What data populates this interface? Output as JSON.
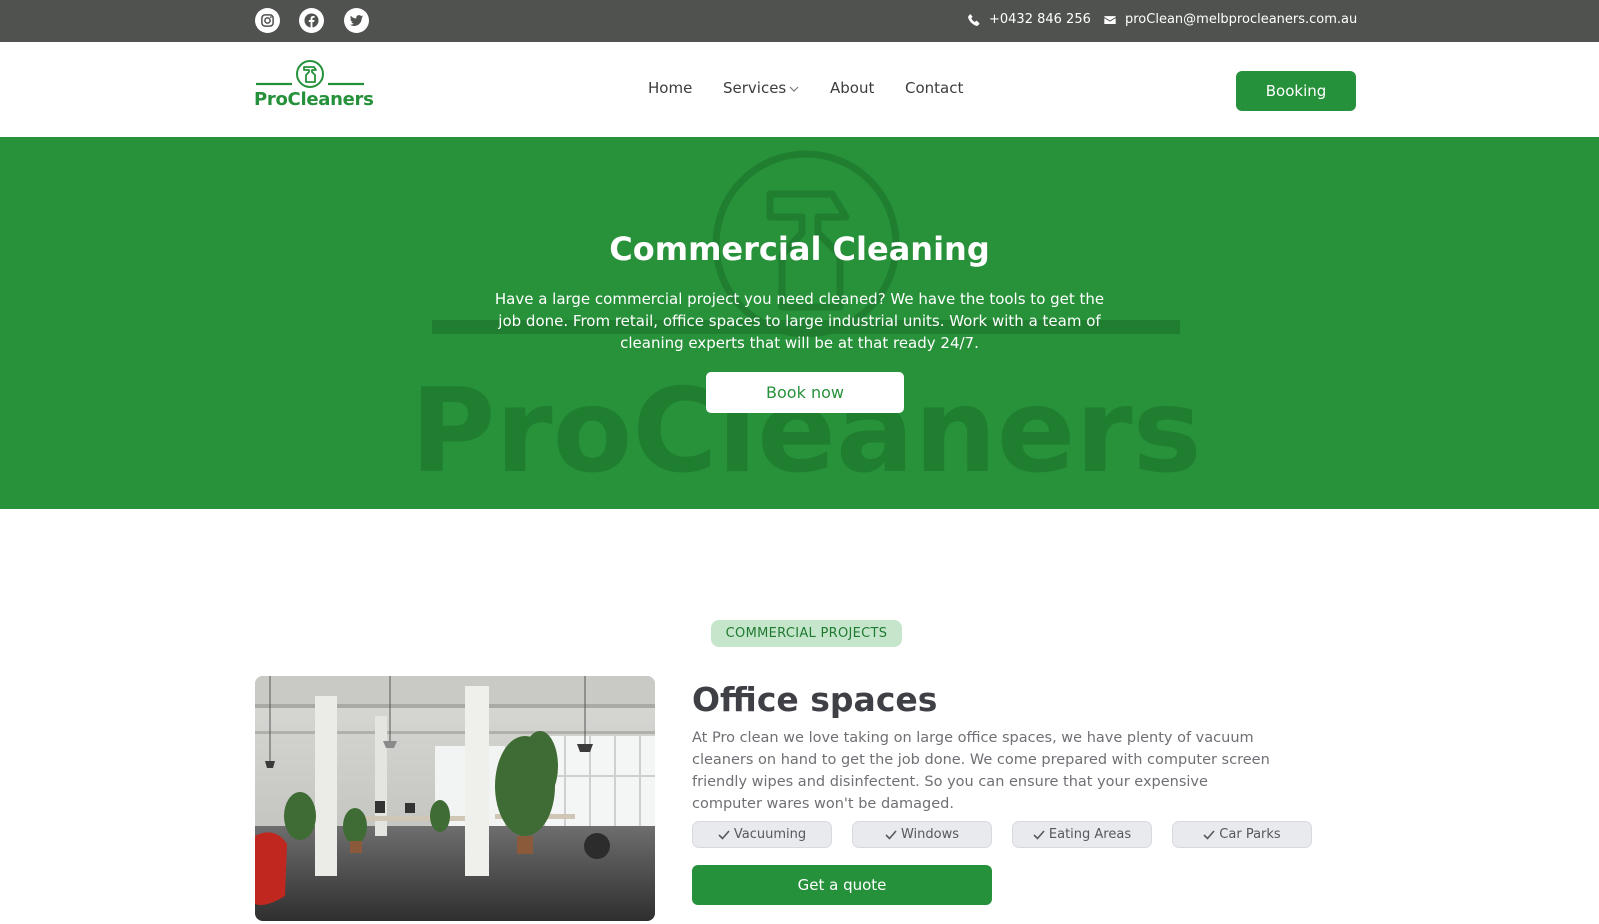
{
  "topbar": {
    "social": [
      {
        "icon": "instagram-icon"
      },
      {
        "icon": "facebook-icon"
      },
      {
        "icon": "twitter-icon"
      }
    ],
    "phone": "+0432 846 256",
    "email": "proClean@melbprocleaners.com.au"
  },
  "nav": {
    "logo_text": "ProCleaners",
    "items": [
      "Home",
      "Services",
      "About",
      "Contact"
    ],
    "booking_label": "Booking"
  },
  "hero": {
    "title": "Commercial Cleaning",
    "description": "Have a large commercial project you need cleaned? We have the tools to get the job done. From retail, office spaces to large industrial units. Work with a team of cleaning experts that will be at that ready 24/7.",
    "button_label": "Book now",
    "watermark_text": "ProCleaners"
  },
  "projects": {
    "section_label": "COMMERCIAL PROJECTS",
    "title": "Office spaces",
    "description": "At Pro clean we love taking on large office spaces, we have plenty of vacuum cleaners on hand to get the job done. We come prepared with computer screen friendly wipes and disinfectent. So you can ensure that your expensive computer wares won't be damaged.",
    "tags": [
      "Vacuuming",
      "Windows",
      "Eating Areas",
      "Car Parks"
    ],
    "quote_label": "Get a quote"
  },
  "colors": {
    "brand_green": "#26913b",
    "topbar_gray": "#4f524f",
    "pill_green": "#c6e6cc"
  }
}
